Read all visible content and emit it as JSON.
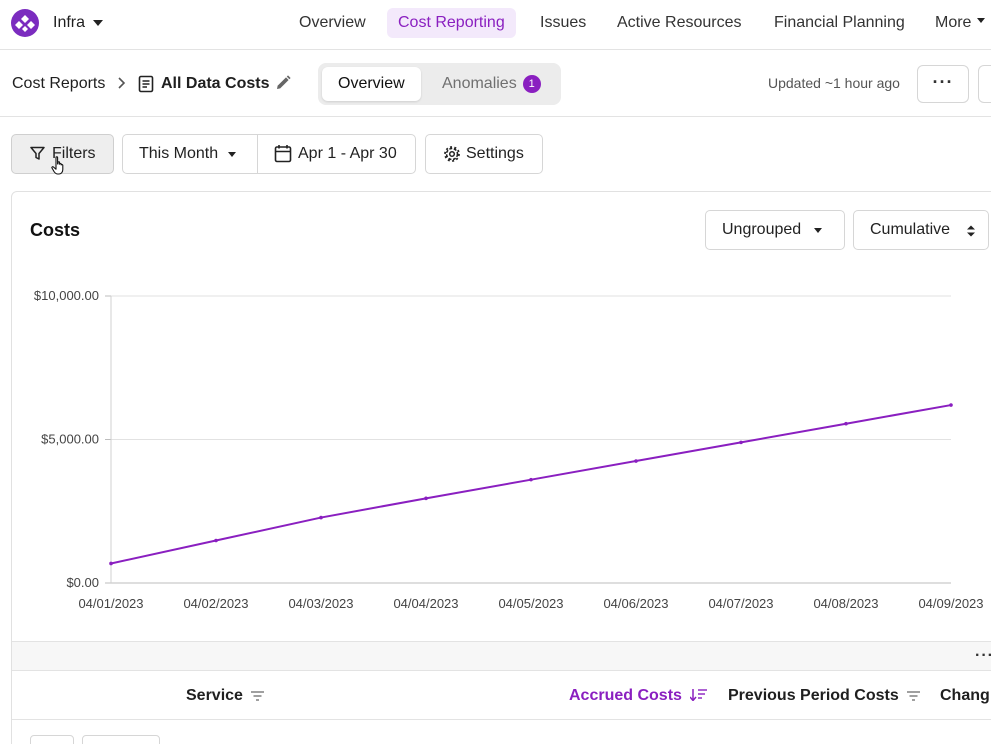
{
  "brand": {
    "org_name": "Infra",
    "accent": "#8a1fc0",
    "logo_color": "#7b2cbf"
  },
  "nav": {
    "links": [
      {
        "label": "Overview",
        "active": false
      },
      {
        "label": "Cost Reporting",
        "active": true
      },
      {
        "label": "Issues",
        "active": false
      },
      {
        "label": "Active Resources",
        "active": false
      },
      {
        "label": "Financial Planning",
        "active": false
      }
    ],
    "more_label": "More"
  },
  "breadcrumb": {
    "parent": "Cost Reports",
    "current": "All Data Costs"
  },
  "view_tabs": {
    "overview": "Overview",
    "anomalies": "Anomalies",
    "anomalies_count": "1"
  },
  "header": {
    "updated": "Updated ~1 hour ago",
    "more_icon": "ellipsis-icon"
  },
  "filters": {
    "filters_label": "Filters",
    "period_label": "This Month",
    "date_range": "Apr 1 - Apr 30",
    "settings_label": "Settings"
  },
  "panel": {
    "title": "Costs",
    "grouping": "Ungrouped",
    "mode": "Cumulative"
  },
  "chart_data": {
    "type": "line",
    "title": "",
    "x": [
      "04/01/2023",
      "04/02/2023",
      "04/03/2023",
      "04/04/2023",
      "04/05/2023",
      "04/06/2023",
      "04/07/2023",
      "04/08/2023",
      "04/09/2023"
    ],
    "series": [
      {
        "values": [
          680,
          1480,
          2280,
          2950,
          3600,
          4250,
          4900,
          5550,
          6200
        ],
        "color": "#8a1fc0"
      }
    ],
    "y_ticks": [
      "$0.00",
      "$5,000.00",
      "$10,000.00"
    ],
    "y_tick_values": [
      0,
      5000,
      10000
    ],
    "ylim": [
      0,
      10000
    ],
    "grid": true
  },
  "table": {
    "columns": [
      {
        "label": "Service",
        "sorted": false
      },
      {
        "label": "Accrued Costs",
        "sorted": true
      },
      {
        "label": "Previous Period Costs",
        "sorted": false
      },
      {
        "label": "Chang",
        "sorted": false
      }
    ]
  }
}
